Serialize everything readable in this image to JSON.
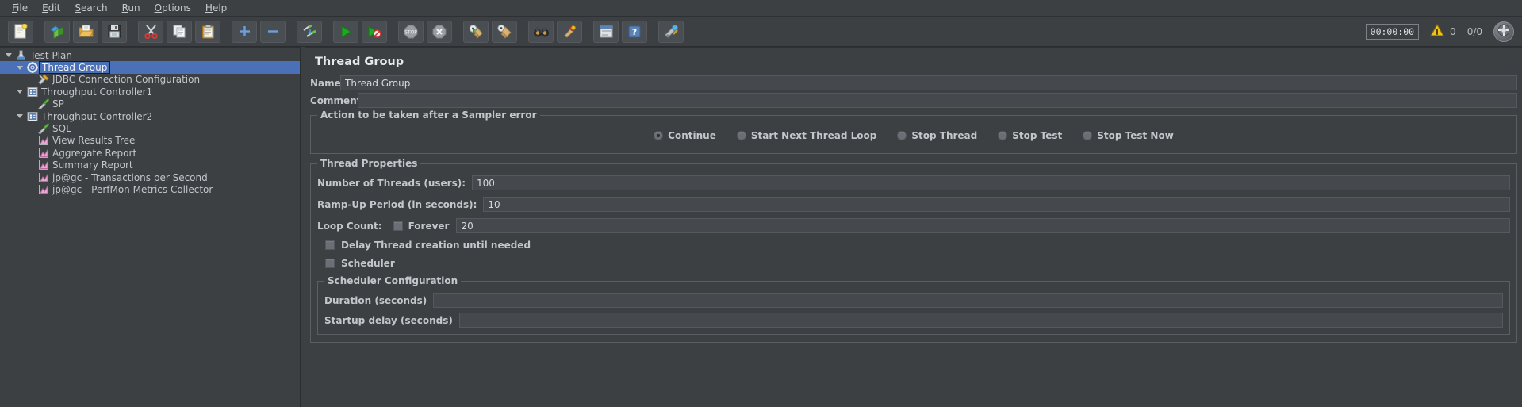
{
  "menubar": {
    "items": [
      {
        "label": "File",
        "mnemonic": "F"
      },
      {
        "label": "Edit",
        "mnemonic": "E"
      },
      {
        "label": "Search",
        "mnemonic": "S"
      },
      {
        "label": "Run",
        "mnemonic": "R"
      },
      {
        "label": "Options",
        "mnemonic": "O"
      },
      {
        "label": "Help",
        "mnemonic": "H"
      }
    ]
  },
  "toolbar": {
    "buttons": [
      {
        "name": "new-button",
        "icon": "new-document-icon",
        "tooltip": "New"
      },
      {
        "name": "templates-button",
        "icon": "templates-icon",
        "tooltip": "Templates"
      },
      {
        "name": "open-button",
        "icon": "open-folder-icon",
        "tooltip": "Open"
      },
      {
        "name": "save-button",
        "icon": "save-floppy-icon",
        "tooltip": "Save Test Plan"
      },
      {
        "name": "cut-button",
        "icon": "scissors-icon",
        "tooltip": "Cut"
      },
      {
        "name": "copy-button",
        "icon": "copy-pages-icon",
        "tooltip": "Copy"
      },
      {
        "name": "paste-button",
        "icon": "clipboard-icon",
        "tooltip": "Paste"
      },
      {
        "name": "expand-all-button",
        "icon": "plus-icon",
        "tooltip": "Expand All"
      },
      {
        "name": "collapse-all-button",
        "icon": "minus-icon",
        "tooltip": "Collapse All"
      },
      {
        "name": "toggle-button",
        "icon": "toggle-arrows-icon",
        "tooltip": "Toggle"
      },
      {
        "name": "start-button",
        "icon": "green-play-icon",
        "tooltip": "Start"
      },
      {
        "name": "start-no-timers-button",
        "icon": "play-no-timers-icon",
        "tooltip": "Start no pauses"
      },
      {
        "name": "stop-button",
        "icon": "stop-sign-icon",
        "tooltip": "Stop"
      },
      {
        "name": "shutdown-button",
        "icon": "shutdown-x-icon",
        "tooltip": "Shutdown"
      },
      {
        "name": "clear-button",
        "icon": "clear-broom-icon",
        "tooltip": "Clear"
      },
      {
        "name": "clear-all-button",
        "icon": "clear-all-broom-icon",
        "tooltip": "Clear All"
      },
      {
        "name": "search-button",
        "icon": "binoculars-icon",
        "tooltip": "Search"
      },
      {
        "name": "reset-search-button",
        "icon": "search-reset-icon",
        "tooltip": "Reset Search"
      },
      {
        "name": "function-helper-button",
        "icon": "function-list-icon",
        "tooltip": "Function Helper Dialog"
      },
      {
        "name": "help-button",
        "icon": "help-question-icon",
        "tooltip": "Help"
      },
      {
        "name": "undo-redo-button",
        "icon": "tools-icon",
        "tooltip": "Tools"
      }
    ],
    "timer": "00:00:00",
    "warning_count": "0",
    "thread_count": "0/0",
    "warning_icon": "warning-triangle-icon",
    "globe_icon": "remote-globe-icon"
  },
  "tree": {
    "nodes": [
      {
        "label": "Test Plan",
        "depth": 0,
        "toggle": "open",
        "icon": "test-plan-icon",
        "selected": false
      },
      {
        "label": "Thread Group",
        "depth": 1,
        "toggle": "open",
        "icon": "thread-group-icon",
        "selected": true
      },
      {
        "label": "JDBC Connection Configuration",
        "depth": 2,
        "toggle": "none",
        "icon": "config-element-icon",
        "selected": false
      },
      {
        "label": "Throughput Controller1",
        "depth": 2,
        "toggle": "open",
        "icon": "controller-icon",
        "selected": false
      },
      {
        "label": "SP",
        "depth": 3,
        "toggle": "none",
        "icon": "sampler-icon",
        "selected": false
      },
      {
        "label": "Throughput Controller2",
        "depth": 2,
        "toggle": "open",
        "icon": "controller-icon",
        "selected": false
      },
      {
        "label": "SQL",
        "depth": 3,
        "toggle": "none",
        "icon": "sampler-icon",
        "selected": false
      },
      {
        "label": "View Results Tree",
        "depth": 2,
        "toggle": "none",
        "icon": "listener-icon",
        "selected": false
      },
      {
        "label": "Aggregate Report",
        "depth": 2,
        "toggle": "none",
        "icon": "listener-icon",
        "selected": false
      },
      {
        "label": "Summary Report",
        "depth": 2,
        "toggle": "none",
        "icon": "listener-icon",
        "selected": false
      },
      {
        "label": "jp@gc - Transactions per Second",
        "depth": 2,
        "toggle": "none",
        "icon": "listener-icon",
        "selected": false
      },
      {
        "label": "jp@gc - PerfMon Metrics Collector",
        "depth": 2,
        "toggle": "none",
        "icon": "listener-icon",
        "selected": false
      }
    ]
  },
  "main": {
    "title": "Thread Group",
    "name_label": "Name:",
    "name_value": "Thread Group",
    "comments_label": "Comments:",
    "comments_value": "",
    "sampler_error": {
      "legend": "Action to be taken after a Sampler error",
      "options": [
        {
          "label": "Continue",
          "selected": true
        },
        {
          "label": "Start Next Thread Loop",
          "selected": false
        },
        {
          "label": "Stop Thread",
          "selected": false
        },
        {
          "label": "Stop Test",
          "selected": false
        },
        {
          "label": "Stop Test Now",
          "selected": false
        }
      ]
    },
    "thread_properties": {
      "legend": "Thread Properties",
      "num_threads_label": "Number of Threads (users):",
      "num_threads_value": "100",
      "ramp_up_label": "Ramp-Up Period (in seconds):",
      "ramp_up_value": "10",
      "loop_count_label": "Loop Count:",
      "forever_label": "Forever",
      "forever_checked": false,
      "loop_count_value": "20",
      "delay_thread_label": "Delay Thread creation until needed",
      "delay_thread_checked": false,
      "scheduler_label": "Scheduler",
      "scheduler_checked": false
    },
    "scheduler_configuration": {
      "legend": "Scheduler Configuration",
      "duration_label": "Duration (seconds)",
      "duration_value": "",
      "startup_delay_label": "Startup delay (seconds)",
      "startup_delay_value": ""
    }
  },
  "colors": {
    "background": "#3c4043",
    "selection": "#4a71b8",
    "text": "#c3c6ca",
    "field_bg": "#45494d",
    "accent_green": "#35b135",
    "warning_yellow": "#f0c419"
  }
}
